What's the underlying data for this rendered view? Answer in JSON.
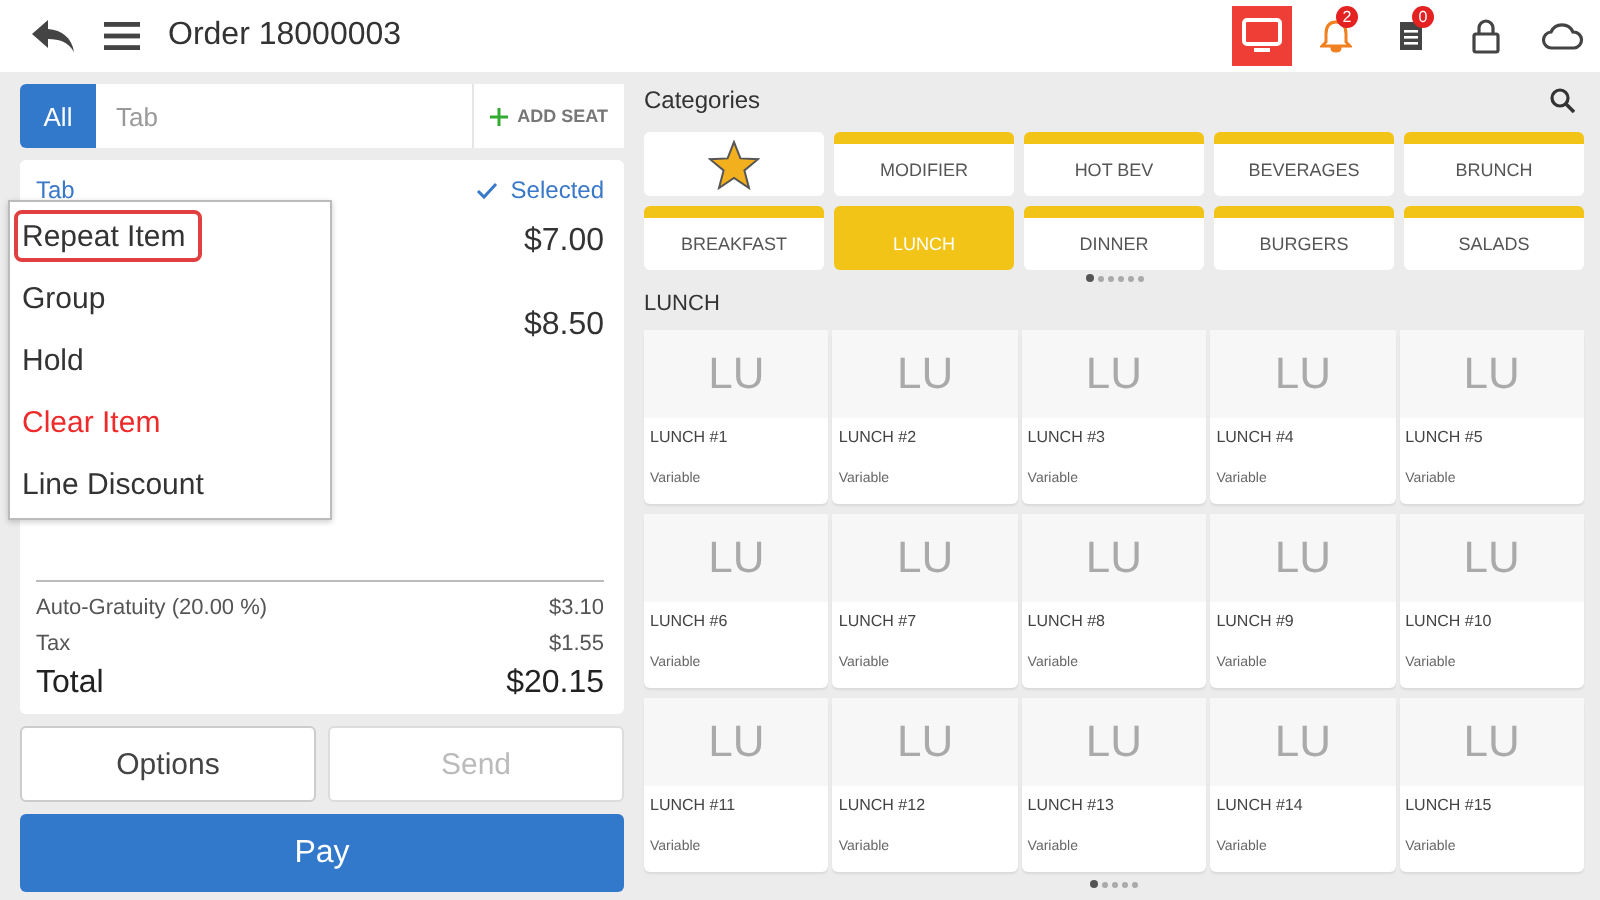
{
  "header": {
    "title": "Order 18000003",
    "notifications_badge": "2",
    "orders_badge": "0",
    "display_active": true
  },
  "seat_tabs": [
    {
      "label": "All",
      "selected": true
    },
    {
      "label": "Tab",
      "selected": false
    }
  ],
  "add_seat": "ADD SEAT",
  "order": {
    "seat_label": "Tab",
    "selected_label": "Selected",
    "item_prices": [
      "$7.00",
      "$8.50"
    ],
    "summary": [
      {
        "label": "Auto-Gratuity (20.00 %)",
        "value": "$3.10"
      },
      {
        "label": "Tax",
        "value": "$1.55"
      }
    ],
    "total": {
      "label": "Total",
      "value": "$20.15"
    }
  },
  "buttons": [
    {
      "label": "Options",
      "disabled": false
    },
    {
      "label": "Send",
      "disabled": true
    }
  ],
  "pay": "Pay",
  "context_menu": [
    {
      "label": "Repeat Item",
      "kind": "highlighted"
    },
    {
      "label": "Group",
      "kind": "normal"
    },
    {
      "label": "Hold",
      "kind": "normal"
    },
    {
      "label": "Clear Item",
      "kind": "danger"
    },
    {
      "label": "Line Discount",
      "kind": "normal"
    }
  ],
  "categories": {
    "title": "Categories",
    "items": [
      {
        "kind": "favorites",
        "selected": false
      },
      {
        "label": "MODIFIER",
        "kind": "category",
        "selected": false
      },
      {
        "label": "HOT BEV",
        "kind": "category",
        "selected": false
      },
      {
        "label": "BEVERAGES",
        "kind": "category",
        "selected": false
      },
      {
        "label": "BRUNCH",
        "kind": "category",
        "selected": false
      },
      {
        "label": "BREAKFAST",
        "kind": "category",
        "selected": false
      },
      {
        "label": "LUNCH",
        "kind": "category",
        "selected": true
      },
      {
        "label": "DINNER",
        "kind": "category",
        "selected": false
      },
      {
        "label": "BURGERS",
        "kind": "category",
        "selected": false
      },
      {
        "label": "SALADS",
        "kind": "category",
        "selected": false
      }
    ],
    "pages": [
      {
        "selected": true
      },
      {
        "selected": false
      },
      {
        "selected": false
      },
      {
        "selected": false
      },
      {
        "selected": false
      },
      {
        "selected": false
      }
    ]
  },
  "products": {
    "title": "LUNCH",
    "items": [
      {
        "initials": "LU",
        "name": "LUNCH #1",
        "price": "Variable"
      },
      {
        "initials": "LU",
        "name": "LUNCH #2",
        "price": "Variable"
      },
      {
        "initials": "LU",
        "name": "LUNCH #3",
        "price": "Variable"
      },
      {
        "initials": "LU",
        "name": "LUNCH #4",
        "price": "Variable"
      },
      {
        "initials": "LU",
        "name": "LUNCH #5",
        "price": "Variable"
      },
      {
        "initials": "LU",
        "name": "LUNCH #6",
        "price": "Variable"
      },
      {
        "initials": "LU",
        "name": "LUNCH #7",
        "price": "Variable"
      },
      {
        "initials": "LU",
        "name": "LUNCH #8",
        "price": "Variable"
      },
      {
        "initials": "LU",
        "name": "LUNCH #9",
        "price": "Variable"
      },
      {
        "initials": "LU",
        "name": "LUNCH #10",
        "price": "Variable"
      },
      {
        "initials": "LU",
        "name": "LUNCH #11",
        "price": "Variable"
      },
      {
        "initials": "LU",
        "name": "LUNCH #12",
        "price": "Variable"
      },
      {
        "initials": "LU",
        "name": "LUNCH #13",
        "price": "Variable"
      },
      {
        "initials": "LU",
        "name": "LUNCH #14",
        "price": "Variable"
      },
      {
        "initials": "LU",
        "name": "LUNCH #15",
        "price": "Variable"
      }
    ],
    "pages": [
      {
        "selected": true
      },
      {
        "selected": false
      },
      {
        "selected": false
      },
      {
        "selected": false
      },
      {
        "selected": false
      }
    ]
  }
}
